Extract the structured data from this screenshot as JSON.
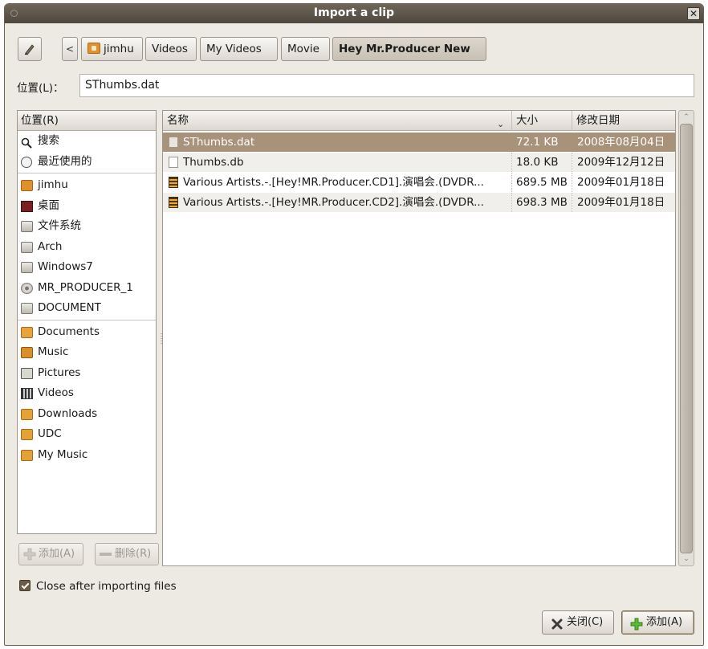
{
  "window": {
    "title": "Import a clip"
  },
  "path_bar": {
    "back_label": "<",
    "crumbs": [
      "jimhu",
      "Videos",
      "My Videos",
      "Movie",
      "Hey Mr.Producer New"
    ]
  },
  "location": {
    "label": "位置(L)：",
    "value": "SThumbs.dat"
  },
  "sidebar": {
    "header": "位置(R)",
    "items": [
      {
        "label": "搜索",
        "icon": "search-icon"
      },
      {
        "label": "最近使用的",
        "icon": "recent-icon"
      },
      {
        "label": "jimhu",
        "icon": "home-folder-icon"
      },
      {
        "label": "桌面",
        "icon": "desktop-icon"
      },
      {
        "label": "文件系统",
        "icon": "drive-icon"
      },
      {
        "label": "Arch",
        "icon": "drive-icon"
      },
      {
        "label": "Windows7",
        "icon": "drive-icon"
      },
      {
        "label": "MR_PRODUCER_1",
        "icon": "disc-icon"
      },
      {
        "label": "DOCUMENT",
        "icon": "drive-icon"
      },
      {
        "label": "Documents",
        "icon": "documents-folder-icon"
      },
      {
        "label": "Music",
        "icon": "music-folder-icon"
      },
      {
        "label": "Pictures",
        "icon": "pictures-folder-icon"
      },
      {
        "label": "Videos",
        "icon": "videos-folder-icon"
      },
      {
        "label": "Downloads",
        "icon": "downloads-folder-icon"
      },
      {
        "label": "UDC",
        "icon": "folder-icon"
      },
      {
        "label": "My Music",
        "icon": "folder-icon"
      }
    ],
    "add_label": "添加(A)",
    "remove_label": "删除(R)"
  },
  "file_list": {
    "columns": {
      "name": "名称",
      "size": "大小",
      "modified": "修改日期"
    },
    "rows": [
      {
        "name": "SThumbs.dat",
        "size": "72.1 KB",
        "modified": "2008年08月04日",
        "icon": "document-icon",
        "selected": true
      },
      {
        "name": "Thumbs.db",
        "size": "18.0 KB",
        "modified": "2009年12月12日",
        "icon": "document-icon",
        "selected": false
      },
      {
        "name": "Various Artists.-.[Hey!MR.Producer.CD1].演唱会.(DVDR...",
        "size": "689.5 MB",
        "modified": "2009年01月18日",
        "icon": "video-file-icon",
        "selected": false
      },
      {
        "name": "Various Artists.-.[Hey!MR.Producer.CD2].演唱会.(DVDR...",
        "size": "698.3 MB",
        "modified": "2009年01月18日",
        "icon": "video-file-icon",
        "selected": false
      }
    ]
  },
  "options": {
    "close_after_import_label": "Close after importing files",
    "close_after_import_checked": true
  },
  "buttons": {
    "close_label": "关闭(C)",
    "add_label": "添加(A)"
  },
  "colors": {
    "selection": "#a9927a",
    "titlebar": "#5a5247",
    "accent_add": "#4caf2a"
  }
}
